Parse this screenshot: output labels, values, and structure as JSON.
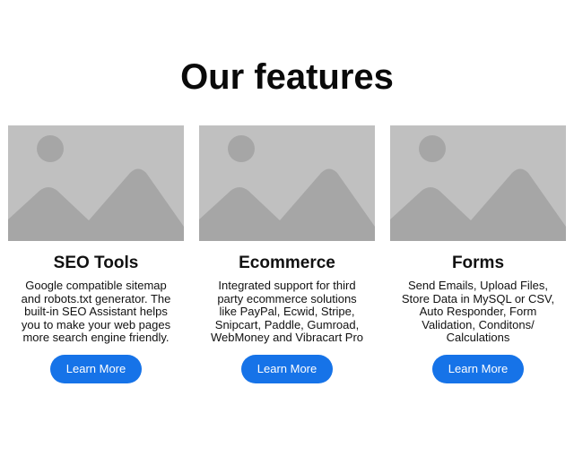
{
  "heading": "Our features",
  "features": [
    {
      "title": "SEO Tools",
      "lines": [
        "Google compatible sitemap",
        "and robots.txt generator. The",
        "built-in SEO Assistant helps",
        "you to make your web pages",
        "more search engine friendly."
      ],
      "button": "Learn More",
      "image_icon": "image-placeholder-icon"
    },
    {
      "title": "Ecommerce",
      "lines": [
        "Integrated support for third",
        "party ecommerce solutions",
        "like PayPal, Ecwid, Stripe,",
        "Snipcart, Paddle, Gumroad,",
        "WebMoney and Vibracart Pro"
      ],
      "button": "Learn More",
      "image_icon": "image-placeholder-icon"
    },
    {
      "title": "Forms",
      "lines": [
        "Send Emails, Upload Files,",
        "Store Data in MySQL or CSV,",
        "Auto Responder, Form",
        "Validation, Conditons/",
        "Calculations"
      ],
      "button": "Learn More",
      "image_icon": "image-placeholder-icon"
    }
  ],
  "colors": {
    "button": "#1673e8",
    "placeholder_bg": "#c0c0c0",
    "placeholder_shape": "#a6a6a6"
  }
}
